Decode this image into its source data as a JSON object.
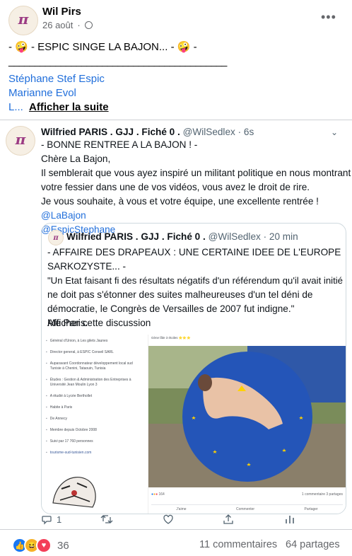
{
  "post": {
    "author": "Wil Pirs",
    "date": "26 août",
    "audience_icon": "globe-icon",
    "menu_icon": "more-horizontal-icon",
    "line1": "- 🤪 - ESPIC SINGE LA BAJON... - 🤪 -",
    "separator": "__________________________________________",
    "tag1": "Stéphane Stef Espic",
    "tag2": "Marianne Evol",
    "tag3_prefix": "L...",
    "see_more": "Afficher la suite"
  },
  "tweet": {
    "author": "Wilfried PARIS . GJJ . Fiché 0 .",
    "handle": "@WilSedlex",
    "time": "· 6s",
    "menu_icon": "chevron-down-icon",
    "line1": "- BONNE RENTREE A LA BAJON ! -",
    "line2": "Chère La Bajon,",
    "line3": "Il semblerait que vous ayez inspiré un militant politique en nous montrant",
    "line4": "votre fessier dans une de vos vidéos, vous avez le droit de rire.",
    "line5": "Je vous souhaite, à vous et votre équipe, une excellente rentrée !",
    "mention1": "@LaBajon",
    "mention2": "@EspicStephane",
    "quoted": {
      "author": "Wilfried PARIS . GJJ . Fiché 0 .",
      "handle": "@WilSedlex",
      "time": "· 20 min",
      "line1": "- AFFAIRE DES DRAPEAUX : UNE CERTAINE IDEE DE L'EUROPE",
      "line2": "SARKOZYSTE... -",
      "line3": "\"Un Etat faisant fi des résultats négatifs d'un référendum qu'il avait initié",
      "line4": "ne doit pas s'étonner des suites malheureuses d'un tel déni de",
      "line5": "démocratie, le Congrès de Versailles de 2007 fut indigne.\"",
      "line6": "Me Paris.",
      "show_thread": "Afficher cette discussion"
    },
    "profile_card": {
      "items": [
        "Général d'Union, à Les gilets Jaunes",
        "Director general, à ESPIC Conseil SARL",
        "Auparavant Coordonnateur développement local sud Tunisie à Chenini, Tataouin, Tunisia",
        "Études : Gestion & Administration des Entreprises à Université Jean Moulin Lyon 3",
        "A étudié à Lycée Berthollet",
        "Habite à Paris",
        "De Annecy",
        "Membre depuis Octobre 2008",
        "Suivi par 17 760 personnes",
        "tourisme-sud-tunisien.com"
      ]
    },
    "photo_card": {
      "header": "Gène fâle 3 étoiles ⭐⭐⭐",
      "reactions_count": "164",
      "comments_shares": "1 commentaire  3 partages",
      "like": "J'aime",
      "comment": "Commenter",
      "share": "Partager"
    },
    "actions": {
      "reply_count": "1",
      "reply_icon": "reply-icon",
      "retweet_icon": "retweet-icon",
      "like_icon": "heart-icon",
      "share_icon": "share-icon",
      "analytics_icon": "analytics-icon"
    }
  },
  "footer": {
    "reaction_count": "36",
    "comments": "11 commentaires",
    "shares": "64 partages",
    "colors": {
      "like": "#1877f2",
      "haha": "#f7b125",
      "love": "#f33e58"
    }
  }
}
